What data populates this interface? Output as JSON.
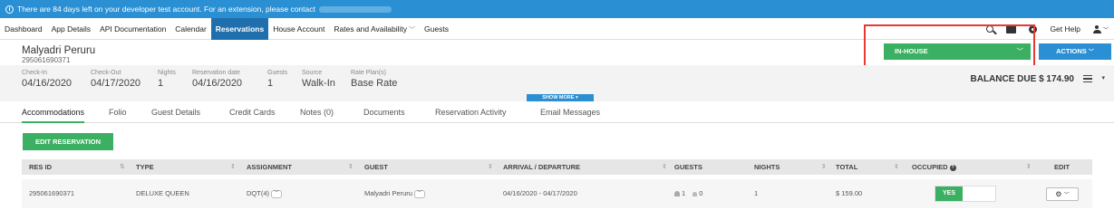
{
  "banner": {
    "text": "There are  84 days left on your developer test account. For an extension, please contact"
  },
  "nav": {
    "items": [
      "Dashboard",
      "App Details",
      "API Documentation",
      "Calendar",
      "Reservations",
      "House Account",
      "Rates and Availability",
      "Guests"
    ],
    "active": "Reservations",
    "get_help": "Get Help"
  },
  "reservation": {
    "guest_name": "Malyadri Peruru",
    "res_id": "295061690371",
    "status": "IN-HOUSE",
    "actions_label": "ACTIONS",
    "balance_due": "BALANCE DUE $ 174.90",
    "show_more": "SHOW MORE",
    "fields": {
      "check_in": {
        "label": "Check-In",
        "value": "04/16/2020"
      },
      "check_out": {
        "label": "Check-Out",
        "value": "04/17/2020"
      },
      "nights": {
        "label": "Nights",
        "value": "1"
      },
      "reservation_date": {
        "label": "Reservation date",
        "value": "04/16/2020"
      },
      "guests": {
        "label": "Guests",
        "value": "1"
      },
      "source": {
        "label": "Source",
        "value": "Walk-In"
      },
      "rate_plan": {
        "label": "Rate Plan(s)",
        "value": "Base Rate"
      }
    }
  },
  "tabs": [
    "Accommodations",
    "Folio",
    "Guest Details",
    "Credit Cards",
    "Notes (0)",
    "Documents",
    "Reservation Activity",
    "Email Messages"
  ],
  "active_tab": "Accommodations",
  "edit_reservation_label": "EDIT RESERVATION",
  "table": {
    "headers": [
      "RES ID",
      "TYPE",
      "ASSIGNMENT",
      "GUEST",
      "ARRIVAL / DEPARTURE",
      "GUESTS",
      "NIGHTS",
      "TOTAL",
      "OCCUPIED",
      "EDIT"
    ],
    "row": {
      "res_id": "295061690371",
      "type": "DELUXE QUEEN",
      "assignment": "DQT(4)",
      "guest": "Malyadri Peruru",
      "dates": "04/16/2020 - 04/17/2020",
      "adults": "1",
      "children": "0",
      "nights": "1",
      "total": "$ 159.00",
      "occupied": "YES"
    }
  },
  "colors": {
    "primary_blue": "#2b8fd3",
    "nav_active": "#1f6fad",
    "green": "#3cb062",
    "highlight_red": "#e53935"
  }
}
